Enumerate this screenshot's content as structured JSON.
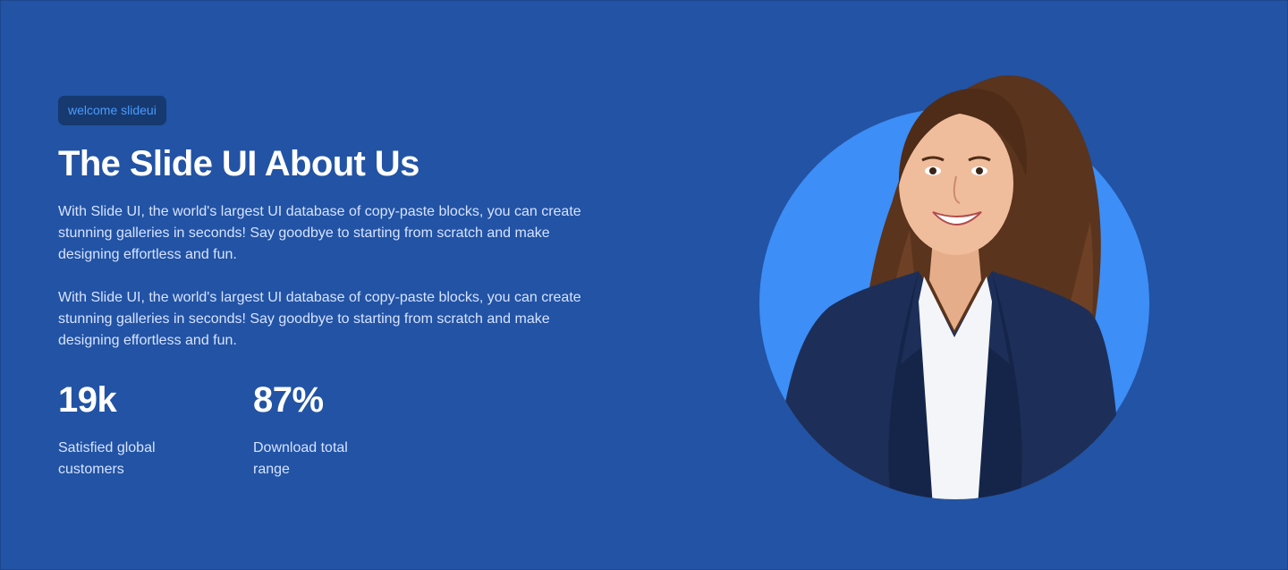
{
  "badge": "welcome slideui",
  "title": "The Slide UI About Us",
  "paragraphs": [
    "With Slide UI, the world's largest UI database of copy-paste blocks, you can create stunning galleries in seconds! Say goodbye to starting from scratch and make designing effortless and fun.",
    "With Slide UI, the world's largest UI database of copy-paste blocks, you can create stunning galleries in seconds! Say goodbye to starting from scratch and make designing effortless and fun."
  ],
  "stats": [
    {
      "value": "19k",
      "label": "Satisfied global customers"
    },
    {
      "value": "87%",
      "label": "Download total range"
    }
  ],
  "colors": {
    "background": "#2253a4",
    "circle": "#3d8ef6",
    "badge_bg": "#163a70",
    "badge_text": "#4a9bff"
  }
}
